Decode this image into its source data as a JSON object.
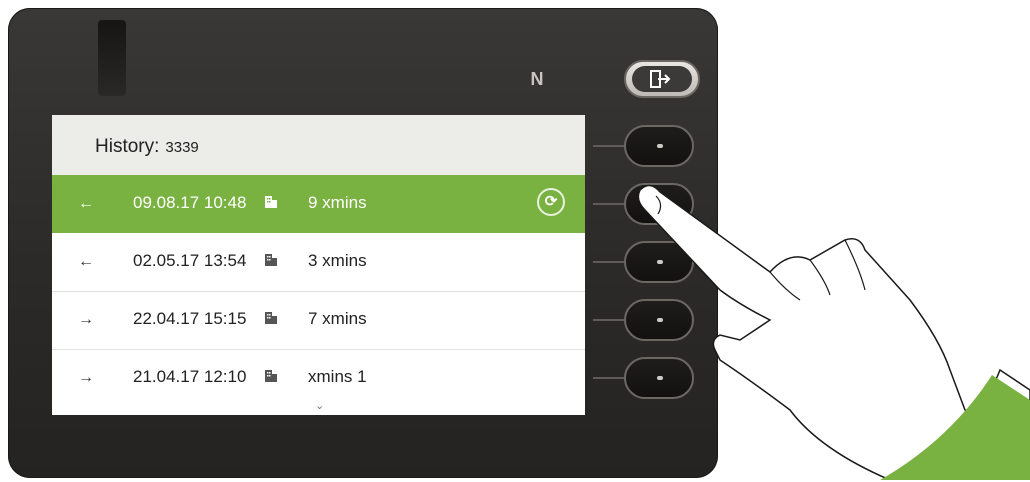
{
  "history": {
    "label": "History:",
    "number": "3339"
  },
  "entries": [
    {
      "direction_icon": "incoming-call-icon",
      "arrow": "←",
      "date": "09.08.17 10:48",
      "name": "9 xmins",
      "selected": true
    },
    {
      "direction_icon": "incoming-call-icon",
      "arrow": "←",
      "date": "02.05.17 13:54",
      "name": "3 xmins",
      "selected": false
    },
    {
      "direction_icon": "outgoing-call-icon",
      "arrow": "→",
      "date": "22.04.17 15:15",
      "name": "7 xmins",
      "selected": false
    },
    {
      "direction_icon": "outgoing-call-icon",
      "arrow": "→",
      "date": "21.04.17 12:10",
      "name": "xmins 1",
      "selected": false
    }
  ],
  "icons": {
    "entry_type": "office-building-icon",
    "action": "refresh-icon",
    "scroll": "chevron-down-icon",
    "exit": "exit-icon",
    "nfc": "nfc-icon"
  },
  "colors": {
    "selection": "#7ab241",
    "device_body": "#2c2a28",
    "header_bg": "#ecece9"
  }
}
